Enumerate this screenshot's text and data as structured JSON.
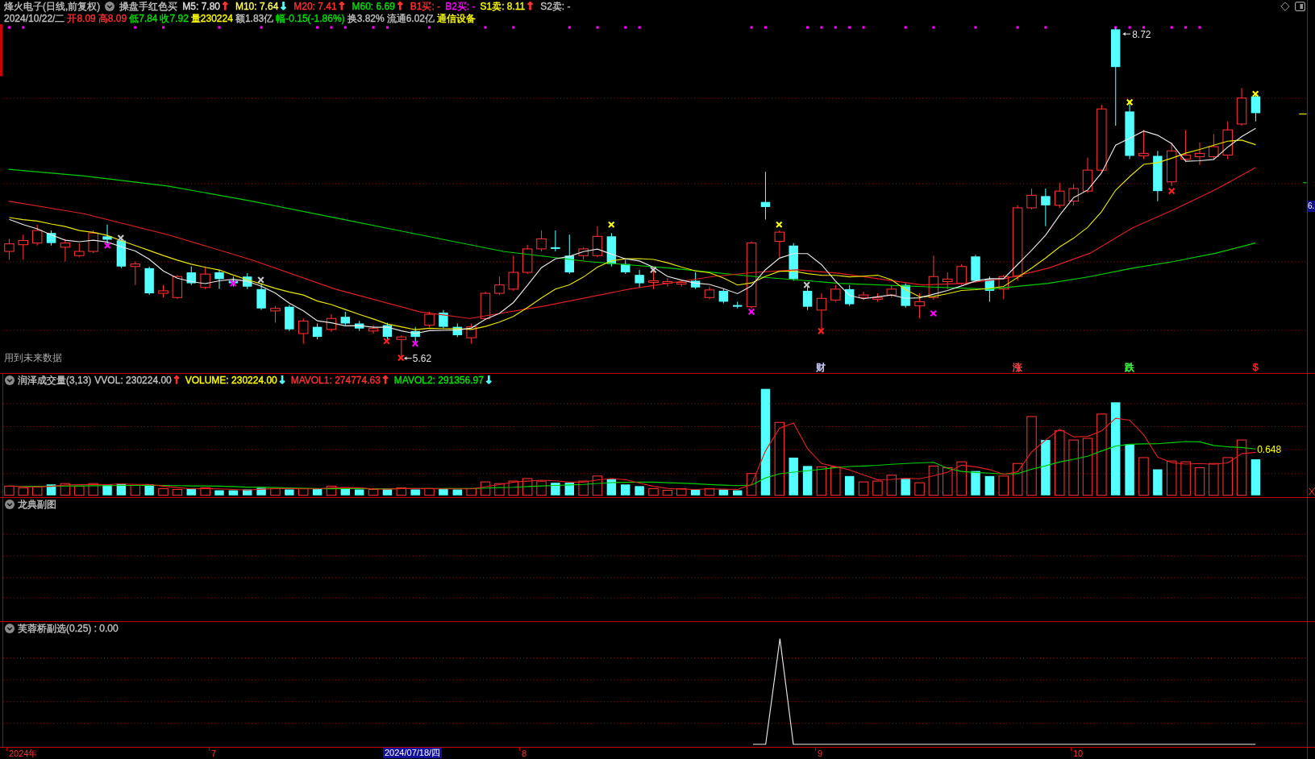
{
  "header": {
    "title": "烽火电子(日线,前复权)",
    "formula": "操盘手红色买",
    "indicators": [
      {
        "label": "M5: 7.80",
        "color": "#e0e0e0",
        "arrow": {
          "text": "↑",
          "color": "#ff3232"
        }
      },
      {
        "label": "M10: 7.64",
        "color": "#ffff54",
        "arrow": {
          "text": "↓",
          "color": "#54ffff"
        }
      },
      {
        "label": "M20: 7.41",
        "color": "#ff3232",
        "arrow": {
          "text": "↑",
          "color": "#ff3232"
        }
      },
      {
        "label": "M60: 6.69",
        "color": "#00e600",
        "arrow": {
          "text": "↑",
          "color": "#ff3232"
        }
      },
      {
        "label": "B1买: -",
        "color": "#ff3232"
      },
      {
        "label": "B2买: -",
        "color": "#ff00ff"
      },
      {
        "label": "S1卖: 8.11",
        "color": "#ffff00",
        "arrow": {
          "text": "↑",
          "color": "#ff3232"
        }
      },
      {
        "label": "S2卖: -",
        "color": "#c0c0c0"
      }
    ]
  },
  "quote": [
    {
      "text": "2024/10/22/二",
      "color": "#c0c0c0"
    },
    {
      "text": "开8.09",
      "color": "#ff3232"
    },
    {
      "text": "高8.09",
      "color": "#ff3232"
    },
    {
      "text": "低7.84",
      "color": "#00e600"
    },
    {
      "text": "收7.92",
      "color": "#00e600"
    },
    {
      "text": "量230224",
      "color": "#ffff00"
    },
    {
      "text": "额1.83亿",
      "color": "#c0c0c0"
    },
    {
      "text": "幅-0.15(-1.86%)",
      "color": "#00e600"
    },
    {
      "text": "换3.82%",
      "color": "#c0c0c0"
    },
    {
      "text": "流通6.02亿",
      "color": "#c0c0c0"
    },
    {
      "text": "通信设备",
      "color": "#ffff00"
    }
  ],
  "main_chart": {
    "high_label": "8.72",
    "low_label": "5.62",
    "note": "用到未来数据",
    "events": [
      {
        "text": "财",
        "color": "#c8c8ff"
      },
      {
        "text": "涨",
        "color": "#ff4040"
      },
      {
        "text": "跌",
        "color": "#40ff40"
      },
      {
        "text": "$",
        "color": "#ff2020"
      }
    ]
  },
  "price_axis": {
    "tag": "6."
  },
  "volume_pane": {
    "title": "润泽成交量(3,13)",
    "readings": [
      {
        "label": "VVOL: 230224.00",
        "color": "#c0c0c0",
        "arrow": {
          "text": "↑",
          "color": "#ff3232"
        }
      },
      {
        "label": "VOLUME: 230224.00",
        "color": "#ffff00",
        "arrow": {
          "text": "↓",
          "color": "#54ffff"
        }
      },
      {
        "label": "MAVOL1: 274774.63",
        "color": "#ff3232",
        "arrow": {
          "text": "↑",
          "color": "#ff3232"
        }
      },
      {
        "label": "MAVOL2: 291356.97",
        "color": "#00e600",
        "arrow": {
          "text": "↓",
          "color": "#54ffff"
        }
      }
    ],
    "value_label": "0.648"
  },
  "sub_pane": {
    "title": "龙典副图"
  },
  "signal_pane": {
    "title": "芙蓉桥副选(0.25) : 0.00"
  },
  "x_axis": {
    "labels": [
      "2024年",
      "7",
      "8",
      "9",
      "10"
    ],
    "cursor_date": "2024/07/18/四"
  }
}
